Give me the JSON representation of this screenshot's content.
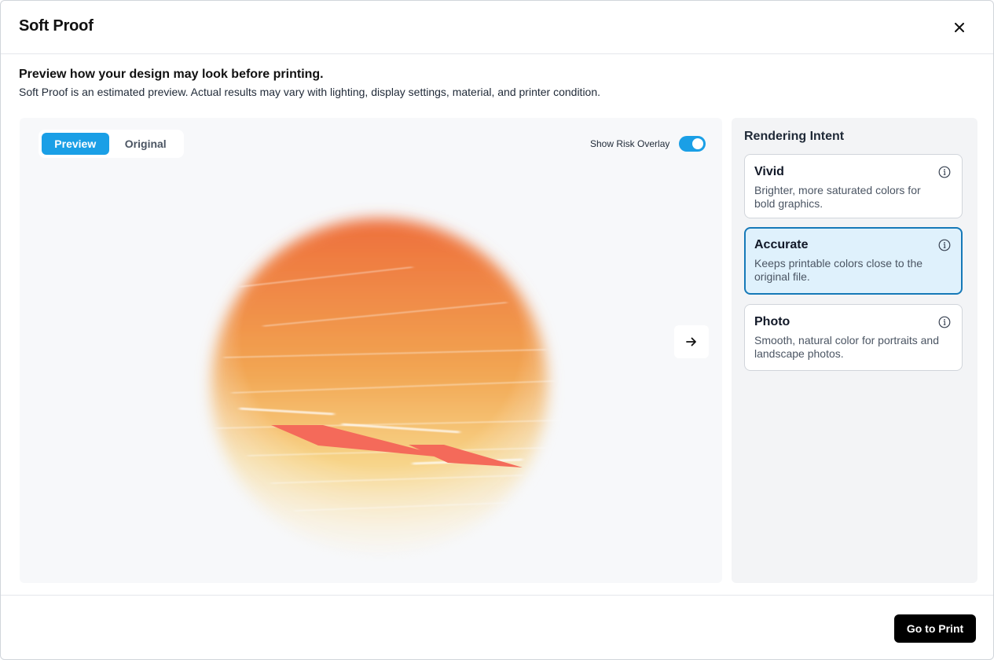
{
  "dialog": {
    "title": "Soft Proof"
  },
  "intro": {
    "heading": "Preview how your design may look before printing.",
    "description": "Soft Proof is an estimated preview. Actual results may vary with lighting, display settings, material, and printer condition."
  },
  "preview": {
    "tabs": [
      {
        "label": "Preview",
        "active": true
      },
      {
        "label": "Original",
        "active": false
      }
    ],
    "overlay_toggle": {
      "label": "Show Risk Overlay",
      "on": true
    }
  },
  "rendering_intent": {
    "title": "Rendering Intent",
    "options": [
      {
        "name": "Vivid",
        "description": "Brighter, more saturated colors for bold graphics.",
        "selected": false
      },
      {
        "name": "Accurate",
        "description": "Keeps printable colors close to the original file.",
        "selected": true
      },
      {
        "name": "Photo",
        "description": "Smooth, natural color for portraits and landscape photos.",
        "selected": false
      }
    ]
  },
  "footer": {
    "primary_label": "Go to Print"
  },
  "colors": {
    "accent": "#1a9fe6",
    "selected_border": "#1679b8",
    "selected_bg": "#dff1fc",
    "risk_overlay": "#f46a5a"
  }
}
